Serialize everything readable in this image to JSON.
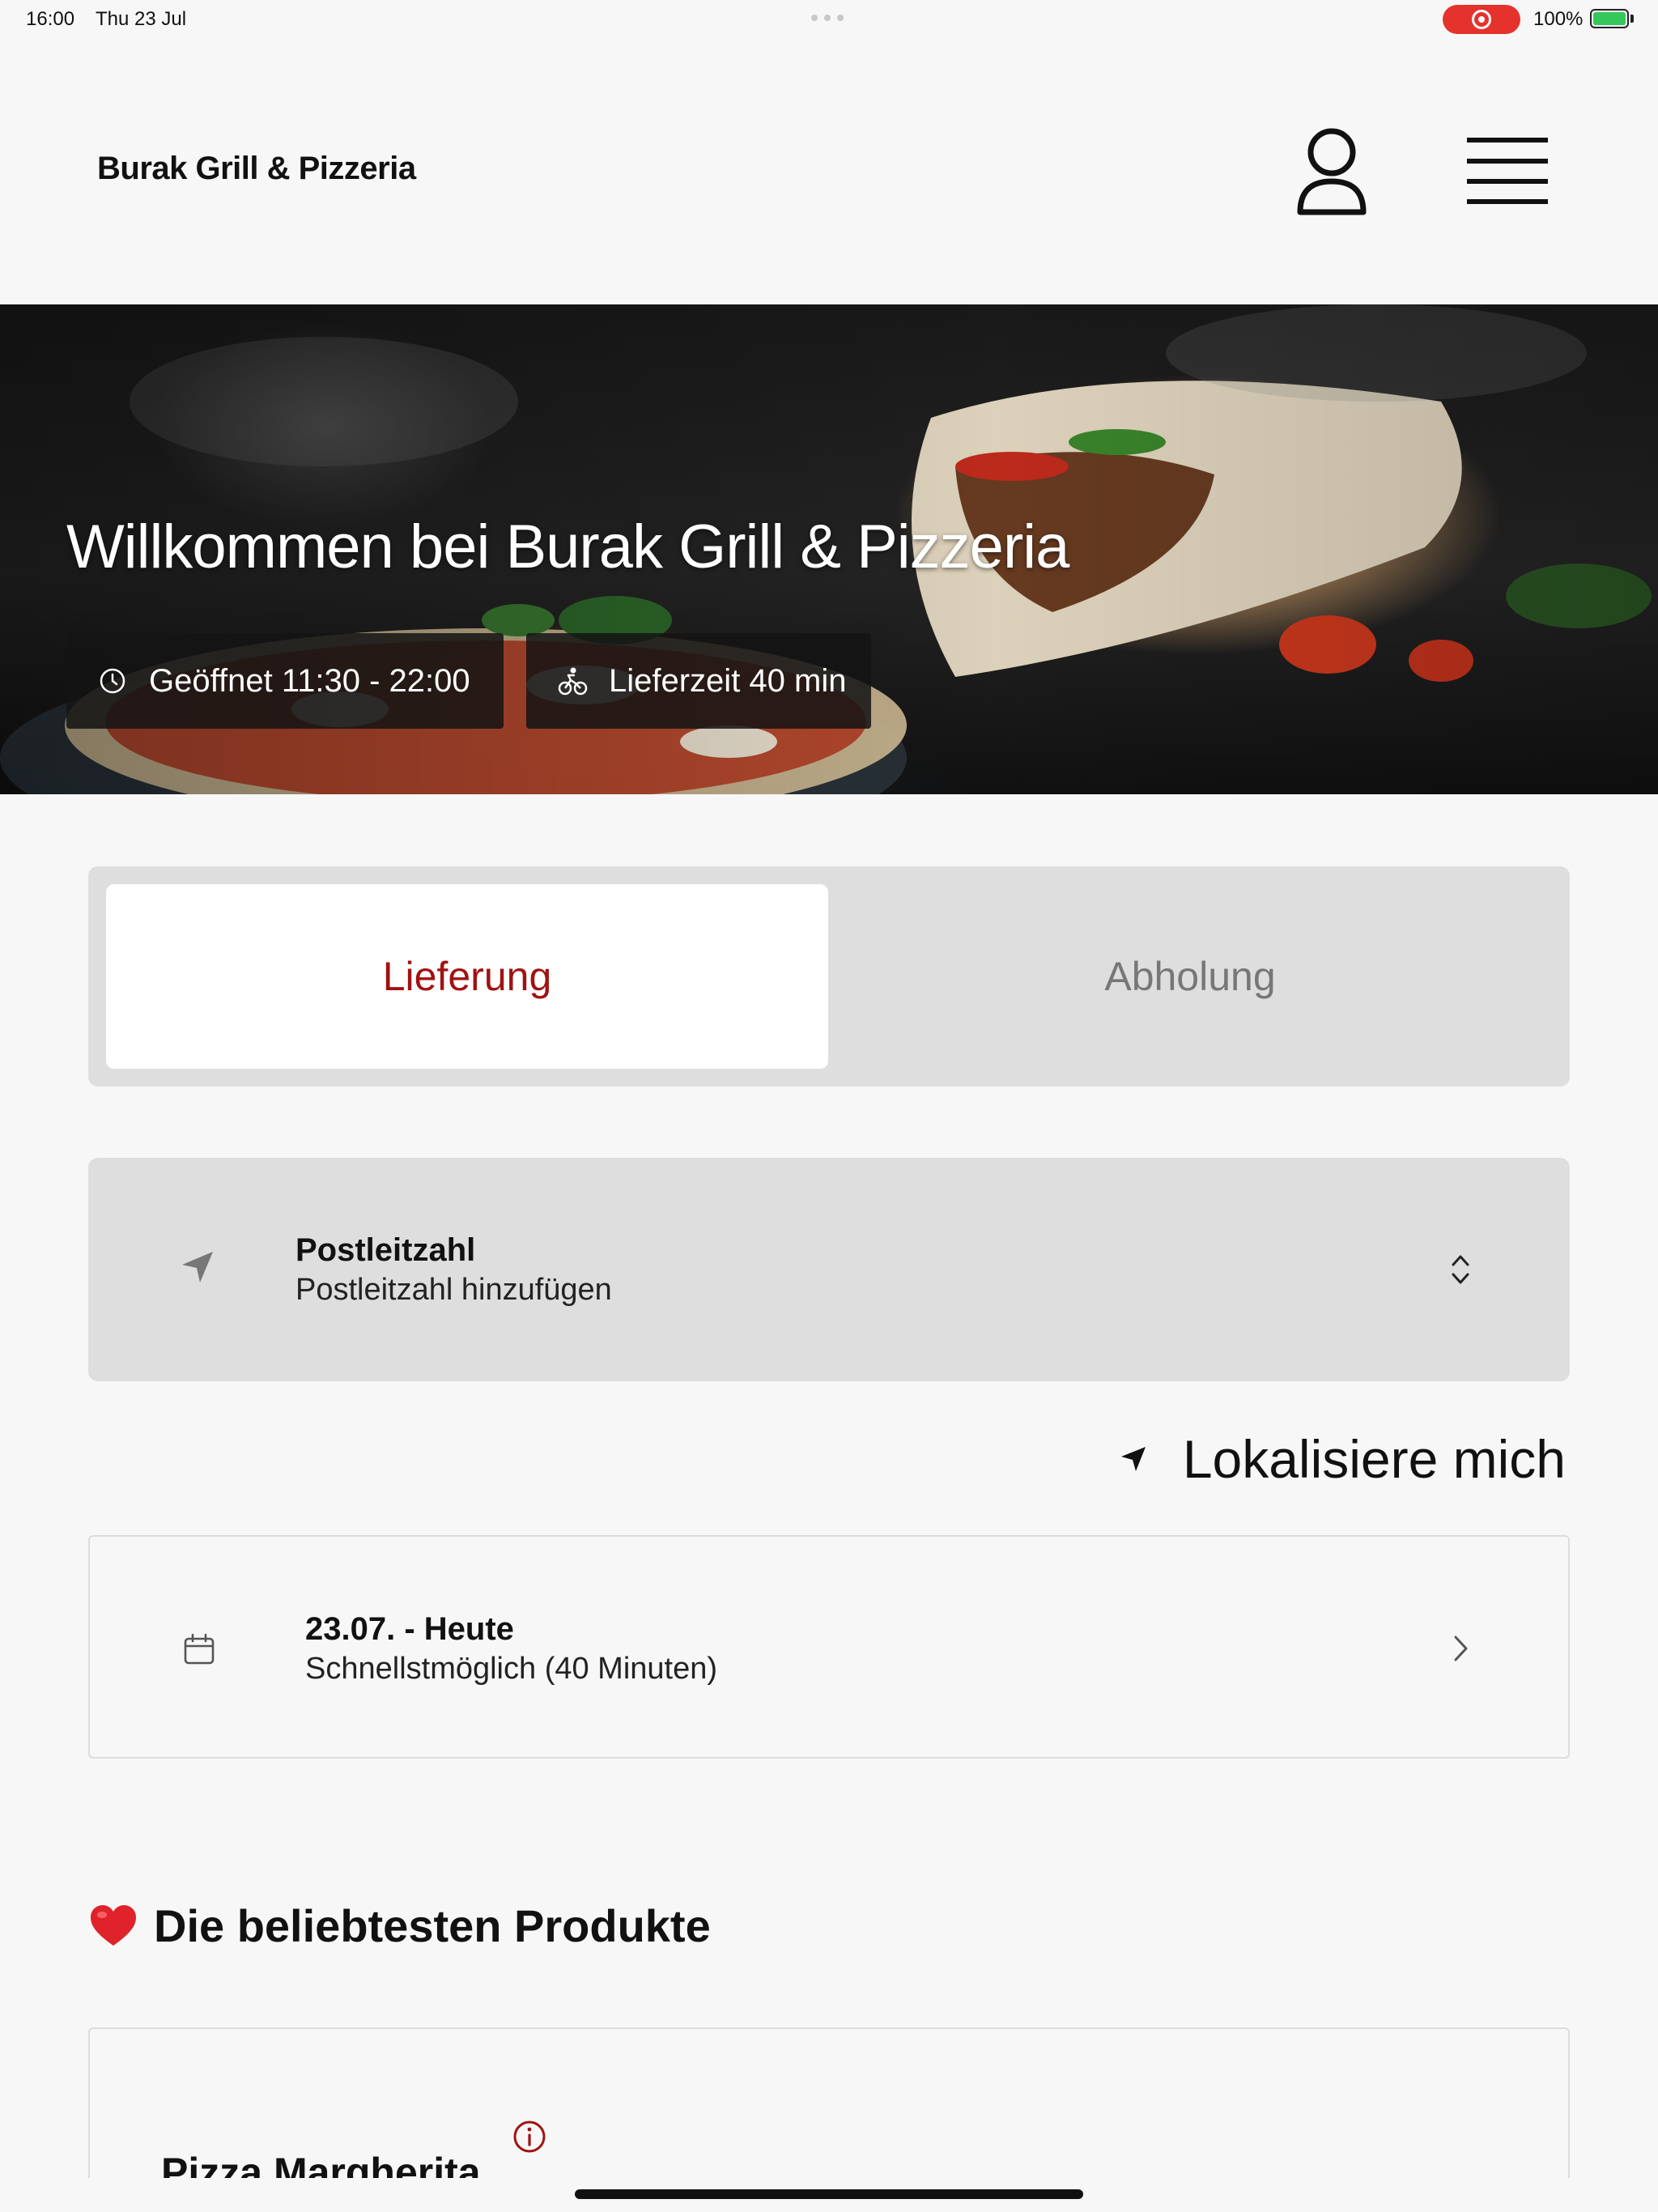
{
  "status_bar": {
    "time": "16:00",
    "date": "Thu 23 Jul",
    "battery_percent": "100%",
    "battery_level": 1.0,
    "recording_color": "#e5322d"
  },
  "header": {
    "brand": "Burak Grill & Pizzeria",
    "account_icon": "user-icon",
    "menu_icon": "hamburger-menu-icon"
  },
  "hero": {
    "title": "Willkommen bei Burak Grill & Pizzeria",
    "opening_hours": "Geöffnet 11:30 - 22:00",
    "delivery_time": "Lieferzeit 40 min",
    "opening_icon": "clock-icon",
    "delivery_icon": "bike-icon"
  },
  "order_mode": {
    "options": [
      "Lieferung",
      "Abholung"
    ],
    "selected": "Lieferung",
    "accent_color": "#a01212"
  },
  "postcode": {
    "label": "Postleitzahl",
    "placeholder": "Postleitzahl hinzufügen",
    "icon": "location-arrow-icon"
  },
  "locate": {
    "label": "Lokalisiere mich",
    "icon": "location-arrow-icon"
  },
  "schedule": {
    "date": "23.07. - Heute",
    "time": "Schnellstmöglich (40 Minuten)",
    "icon": "calendar-icon"
  },
  "popular": {
    "heading": "Die beliebtesten Produkte",
    "heading_icon": "heart-icon",
    "products": [
      {
        "name": "Pizza Margherita",
        "info_icon": "info-icon"
      }
    ]
  }
}
